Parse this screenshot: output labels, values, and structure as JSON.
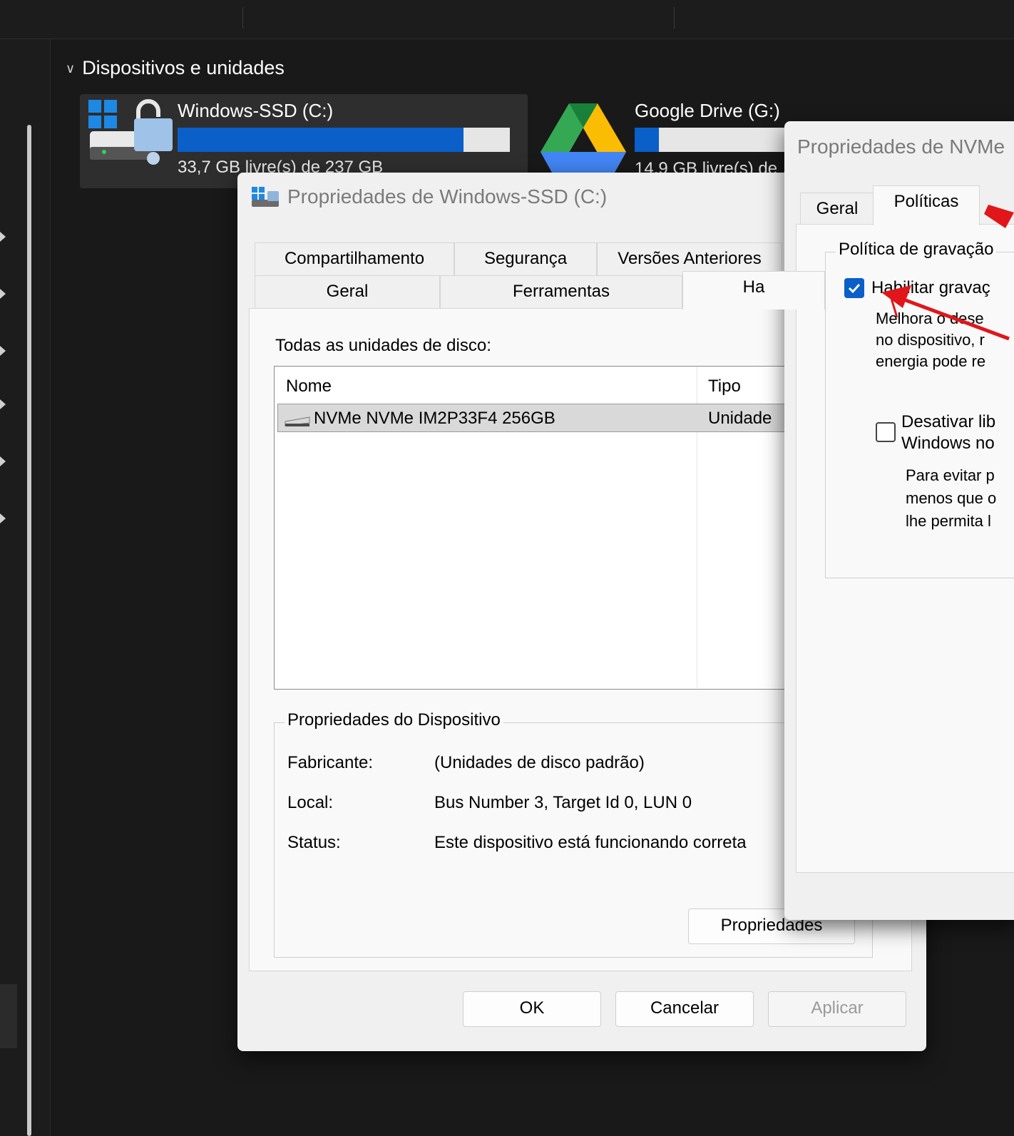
{
  "explorer": {
    "section_header": "Dispositivos e unidades",
    "drives": [
      {
        "name": "Windows-SSD (C:)",
        "free_text": "33,7 GB livre(s) de 237 GB",
        "used_fraction": 0.86
      },
      {
        "name": "Google Drive (G:)",
        "free_text": "14,9 GB livre(s) de ...",
        "used_fraction": 0.1
      }
    ]
  },
  "dialog_c": {
    "title": "Propriedades de Windows-SSD (C:)",
    "tabs_row1": [
      "Compartilhamento",
      "Segurança",
      "Versões Anteriores"
    ],
    "tabs_row2": [
      "Geral",
      "Ferramentas",
      "Ha"
    ],
    "disks_label": "Todas as unidades de disco:",
    "columns": [
      "Nome",
      "Tipo"
    ],
    "disk_rows": [
      {
        "name": "NVMe NVMe IM2P33F4 256GB",
        "type": "Unidade"
      }
    ],
    "device_group_title": "Propriedades do Dispositivo",
    "manufacturer_label": "Fabricante:",
    "manufacturer_value": "(Unidades de disco padrão)",
    "location_label": "Local:",
    "location_value": "Bus Number 3, Target Id 0, LUN 0",
    "status_label": "Status:",
    "status_value": "Este dispositivo está funcionando correta",
    "properties_button": "Propriedades",
    "ok_button": "OK",
    "cancel_button": "Cancelar",
    "apply_button": "Aplicar"
  },
  "dialog_nvme": {
    "title": "Propriedades de NVMe",
    "tabs": [
      "Geral",
      "Políticas"
    ],
    "group_title": "Política de gravação",
    "enable_write_cache": {
      "label": "Habilitar gravaç",
      "checked": true
    },
    "enable_desc": [
      "Melhora o dese",
      "no dispositivo, r",
      "energia pode re"
    ],
    "disable_flush": {
      "label_line1": "Desativar lib",
      "label_line2": "Windows no",
      "checked": false
    },
    "disable_desc": [
      "Para evitar p",
      "menos que o",
      "lhe permita l"
    ]
  },
  "colors": {
    "accent": "#0a5fc8",
    "annotation_arrow": "#e0161b",
    "explorer_bg": "#191919",
    "dialog_bg": "#f0f0f0"
  }
}
